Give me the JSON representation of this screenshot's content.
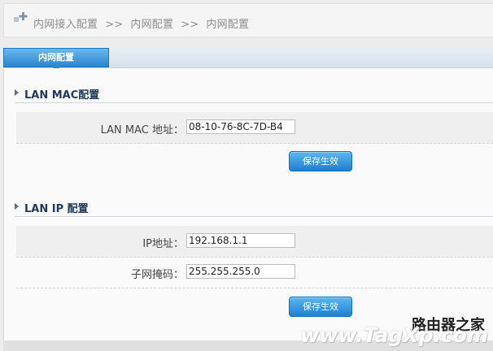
{
  "breadcrumb": {
    "items": [
      "内网接入配置",
      "内网配置",
      "内网配置"
    ],
    "separator": ">>"
  },
  "tab": {
    "label": "内网配置"
  },
  "sections": {
    "lan_mac": {
      "title": "LAN MAC配置",
      "mac_label": "LAN MAC 地址：",
      "mac_value": "08-10-76-8C-7D-B4",
      "save_label": "保存生效"
    },
    "lan_ip": {
      "title": "LAN IP 配置",
      "ip_label": "IP地址：",
      "ip_value": "192.168.1.1",
      "mask_label": "子网掩码：",
      "mask_value": "255.255.255.0",
      "save_label": "保存生效"
    }
  },
  "watermark": {
    "line1": "路由器之家",
    "line2": "www.TagXp.com"
  },
  "colors": {
    "accent": "#2a86cf",
    "section_title": "#1f3a5c",
    "breadcrumb_text": "#8e8e8e"
  },
  "icons": {
    "breadcrumb": "add-icon"
  }
}
